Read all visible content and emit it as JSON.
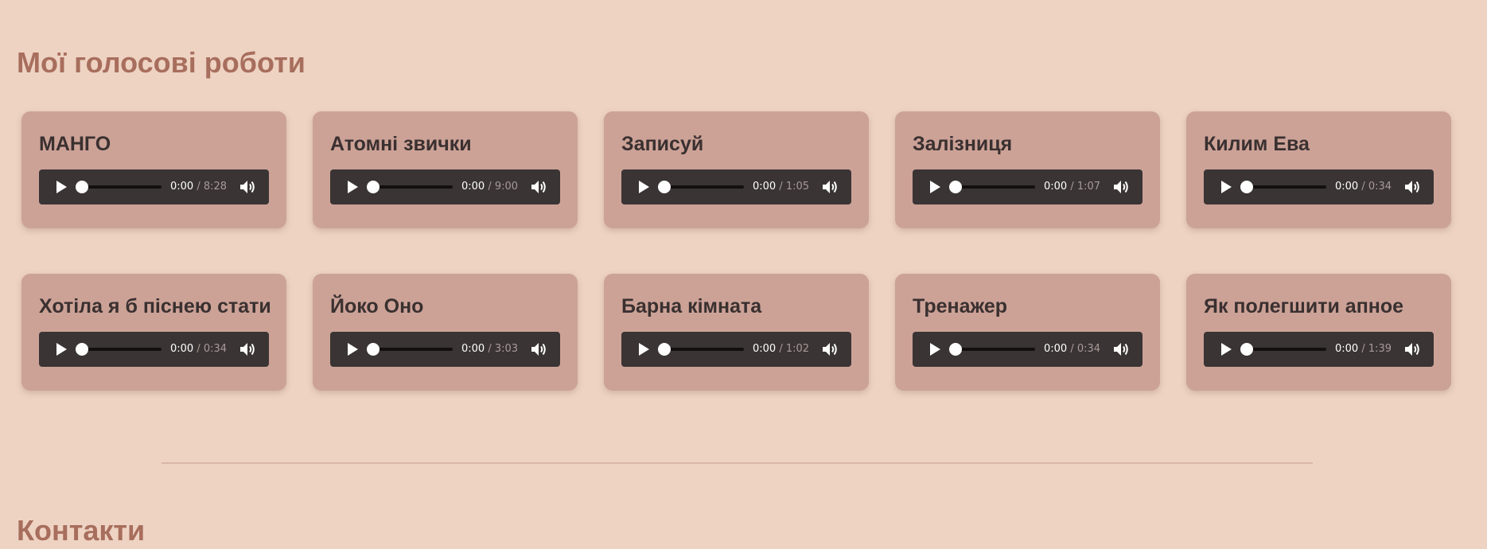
{
  "sections": {
    "works_title": "Мої голосові роботи",
    "contacts_title": "Контакти"
  },
  "icons": {
    "play": "play-icon",
    "volume": "volume-icon"
  },
  "colors": {
    "background": "#eed3c3",
    "card": "#cca297",
    "heading": "#a86e5d",
    "player": "#3a3434"
  },
  "recordings": [
    {
      "title": "МАНГО",
      "current": "0:00",
      "separator": "/",
      "duration": "8:28"
    },
    {
      "title": "Атомні звички",
      "current": "0:00",
      "separator": "/",
      "duration": "9:00"
    },
    {
      "title": "Записуй",
      "current": "0:00",
      "separator": "/",
      "duration": "1:05"
    },
    {
      "title": "Залізниця",
      "current": "0:00",
      "separator": "/",
      "duration": "1:07"
    },
    {
      "title": "Килим Ева",
      "current": "0:00",
      "separator": "/",
      "duration": "0:34"
    },
    {
      "title": "Хотіла я б піснею стати",
      "current": "0:00",
      "separator": "/",
      "duration": "0:34"
    },
    {
      "title": "Йоко Оно",
      "current": "0:00",
      "separator": "/",
      "duration": "3:03"
    },
    {
      "title": "Барна кімната",
      "current": "0:00",
      "separator": "/",
      "duration": "1:02"
    },
    {
      "title": "Тренажер",
      "current": "0:00",
      "separator": "/",
      "duration": "0:34"
    },
    {
      "title": "Як полегшити апное",
      "current": "0:00",
      "separator": "/",
      "duration": "1:39"
    }
  ]
}
